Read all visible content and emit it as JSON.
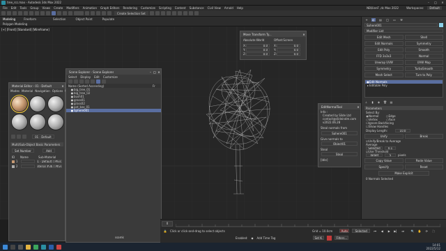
{
  "app": {
    "title": "tree_rcc.max - Autodesk 3ds Max 2022",
    "workspace_label": "Workspaces:",
    "workspace_value": "Default"
  },
  "menu": {
    "items": [
      "File",
      "Edit",
      "Tools",
      "Group",
      "Views",
      "Create",
      "Modifiers",
      "Animation",
      "Graph Editors",
      "Rendering",
      "Customize",
      "Scripting",
      "Content",
      "Substance",
      "Civil View",
      "Arnold",
      "Help"
    ]
  },
  "toolbar": {
    "selection_set_placeholder": "Create Selection Set",
    "user_label": "NB\\ilienF ,dc Max 2022"
  },
  "ribbon": {
    "tabs": [
      "Modeling",
      "Freeform",
      "Selection",
      "Object Paint",
      "Populate"
    ],
    "sub_label": "Polygon Modeling"
  },
  "viewport": {
    "label": "[+] [Front] [Standard] [Wireframe]"
  },
  "material_editor": {
    "title": "Material Editor - 01 - Default",
    "menu": [
      "Modes",
      "Material",
      "Navigation",
      "Options",
      "Utilities"
    ],
    "material_name": "01 - Default",
    "rollout_title": "Multi/Sub-Object Basic Parameters",
    "set_number_label": "Set Number",
    "add_label": "Add",
    "col_id": "ID",
    "col_name": "Name",
    "col_submat": "Sub-Material",
    "rows": [
      {
        "id": "1",
        "name": "",
        "sub": "01 - Default ( Physic"
      },
      {
        "id": "2",
        "name": "",
        "sub": "Material #36 ( Physic"
      }
    ]
  },
  "scene_explorer": {
    "title": "Scene Explorer - Scene Explorer",
    "menu": [
      "Select",
      "Display",
      "Edit",
      "Customize"
    ],
    "column": "Name (Sorted Ascending)",
    "frozen_col": "Fr",
    "items": [
      "big_tree_01",
      "big_tree_02",
      "bush01",
      "grass01",
      "grass02",
      "pot_bas_01",
      "Sphere001"
    ]
  },
  "transform_typein": {
    "title": "Move Transform Ty...",
    "abs_label": "Absolute:World",
    "off_label": "Offset:Screen",
    "abs": {
      "x": "0.0",
      "y": "0.0",
      "z": "0.0"
    },
    "off": {
      "x": "0.0",
      "y": "0.0",
      "z": "0.0"
    }
  },
  "edit_normal_tool": {
    "title": "EditNormalTool",
    "info_label": "Info :",
    "created_by": "Created by Slide Ltd",
    "email": "contact@slideindm.com",
    "date": "v2022.06.28",
    "steal_label": "Steal normals from",
    "steal_btn": "Sphere001",
    "give_label": "Give normals to",
    "give_btn": "Object01",
    "steal2_label": "Steal",
    "steal2_btn": "Steal",
    "status": "[Idle]"
  },
  "command_panel": {
    "object_name": "Sphere001",
    "modifier_list": "Modifier List",
    "buttons": [
      "Edit Mesh",
      "Shell",
      "Edit Normals",
      "Symmetry",
      "Edit Poly",
      "Smooth",
      "FFD 3x3x3",
      "Normal",
      "Unwrap UVW",
      "UVW Map",
      "Symmetry",
      "TurboSmooth",
      "Mesh Select",
      "Turn to Poly"
    ],
    "stack": [
      "Edit Normals",
      "Editable Poly"
    ],
    "params_title": "Parameters",
    "select_by": "Select By:",
    "radio": [
      "Normal",
      "Edge",
      "Vertex",
      "Face"
    ],
    "ignore_backfacing": "Ignore Backfacing",
    "show_handles": "Show Handles",
    "display_length_label": "Display Length:",
    "display_length": "10.0",
    "unify": "Unify",
    "break": "Break",
    "unify_to_average": "Unify/Break to Average",
    "average": "Average",
    "selected": "Selected",
    "selected_val": "0.1",
    "use_threshold": "Use Threshold",
    "target": "Target",
    "target_val": "5",
    "pixels": "pixels",
    "copy_value": "Copy Value",
    "paste_value": "Paste Value",
    "specify": "Specify",
    "reset": "Reset",
    "make_explicit": "Make Explicit",
    "status": "0 Normals Selected"
  },
  "status": {
    "grid": "Grid = 10.0cm",
    "add_time_tag": "Add Time Tag",
    "auto": "Auto",
    "selected": "Selected",
    "set_key": "Set K.",
    "filters": "Filters...",
    "frame": "0",
    "enabled": "Enabled:",
    "prompt": "Click or click-and-drag to select objects",
    "script": "ssamk"
  },
  "clock": {
    "time": "14:01",
    "date": "2022/5/12"
  },
  "colors": {
    "selection": "#5a6ea0",
    "accent": "#ffd23f",
    "key": "#c43a3a"
  }
}
